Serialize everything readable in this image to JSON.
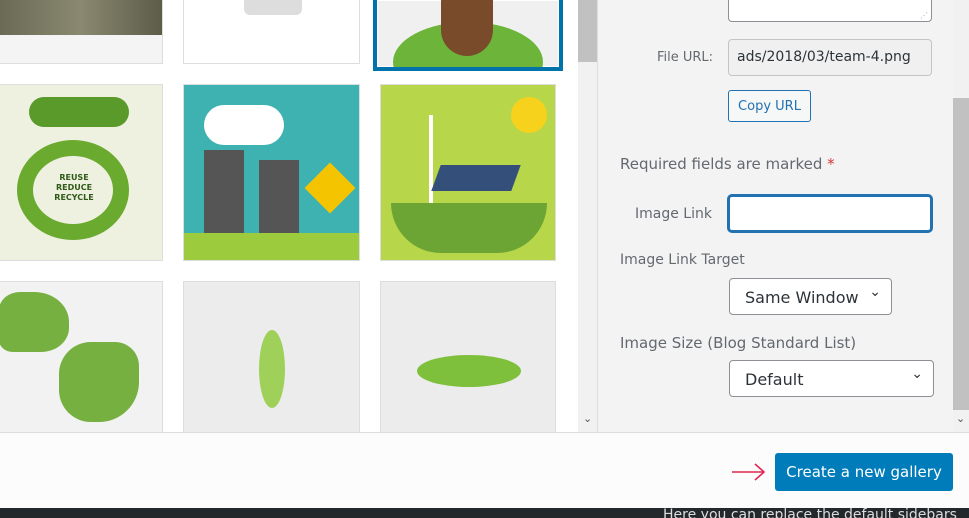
{
  "attachment_details": {
    "file_url_label": "File URL:",
    "file_url_value": "ads/2018/03/team-4.png",
    "copy_url_label": "Copy URL",
    "required_note": "Required fields are marked",
    "required_mark": "*",
    "image_link_label": "Image Link",
    "image_link_value": "",
    "image_link_target_label": "Image Link Target",
    "image_link_target_value": "Same Window",
    "image_size_label": "Image Size (Blog Standard List)",
    "image_size_value": "Default"
  },
  "footer": {
    "create_gallery_label": "Create a new gallery",
    "arrow_color": "#e2264d"
  },
  "media": [
    {
      "name": "partial-photo"
    },
    {
      "name": "shirt"
    },
    {
      "name": "team-4",
      "selected": true
    },
    {
      "name": "reuse-reduce-recycle",
      "text": "REUSE REDUCE RECYCLE"
    },
    {
      "name": "nuclear-plant"
    },
    {
      "name": "wind-solar"
    },
    {
      "name": "world-map"
    },
    {
      "name": "leaf-vertical"
    },
    {
      "name": "leaf-horizontal"
    }
  ],
  "background_text": "Here you can replace the default sidebars",
  "colors": {
    "accent": "#007cba",
    "selected_border": "#0073aa"
  }
}
